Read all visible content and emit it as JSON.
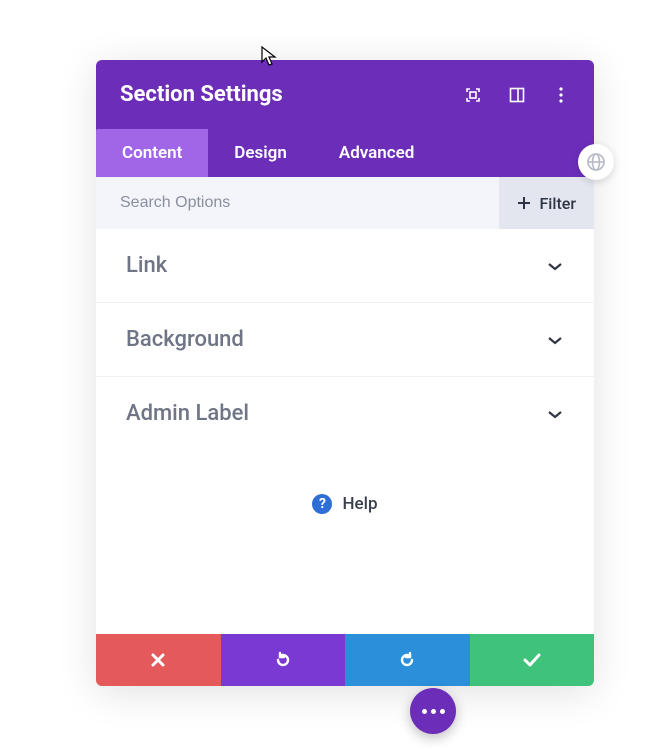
{
  "header": {
    "title": "Section Settings"
  },
  "tabs": [
    {
      "label": "Content",
      "active": true
    },
    {
      "label": "Design",
      "active": false
    },
    {
      "label": "Advanced",
      "active": false
    }
  ],
  "search": {
    "placeholder": "Search Options"
  },
  "filter": {
    "label": "Filter"
  },
  "sections": [
    {
      "label": "Link"
    },
    {
      "label": "Background"
    },
    {
      "label": "Admin Label"
    }
  ],
  "help": {
    "label": "Help"
  },
  "colors": {
    "primary": "#6c2eb9",
    "primary_light": "#a166e8",
    "danger": "#e45a5a",
    "info": "#2c8fd9",
    "success": "#3fc37b"
  }
}
